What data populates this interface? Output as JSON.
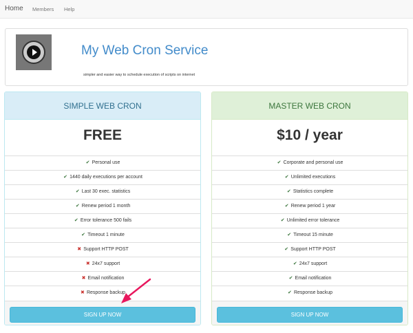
{
  "nav": {
    "brand": "Home",
    "links": [
      "Members",
      "Help"
    ]
  },
  "header": {
    "logo_icon": "play-clock-icon",
    "title": "My Web Cron Service",
    "tagline": "simpler and easier way to schedule execution of scripts on internet"
  },
  "plans": [
    {
      "name": "SIMPLE WEB CRON",
      "price": "FREE",
      "features": [
        {
          "text": "Personal use",
          "included": true
        },
        {
          "text": "1440 daily executions per account",
          "included": true
        },
        {
          "text": "Last 30 exec. statistics",
          "included": true
        },
        {
          "text": "Renew period 1 month",
          "included": true
        },
        {
          "text": "Error tolerance 500 fails",
          "included": true
        },
        {
          "text": "Timeout 1 minute",
          "included": true
        },
        {
          "text": "Support HTTP POST",
          "included": false
        },
        {
          "text": "24x7 support",
          "included": false
        },
        {
          "text": "Email notification",
          "included": false
        },
        {
          "text": "Response backup",
          "included": false
        }
      ],
      "button": "SIGN UP NOW"
    },
    {
      "name": "MASTER WEB CRON",
      "price": "$10 / year",
      "features": [
        {
          "text": "Corporate and personal use",
          "included": true
        },
        {
          "text": "Unlimited executions",
          "included": true
        },
        {
          "text": "Statistics complete",
          "included": true
        },
        {
          "text": "Renew period 1 year",
          "included": true
        },
        {
          "text": "Unlimited error tolerance",
          "included": true
        },
        {
          "text": "Timeout 15 minute",
          "included": true
        },
        {
          "text": "Support HTTP POST",
          "included": true
        },
        {
          "text": "24x7 support",
          "included": true
        },
        {
          "text": "Email notification",
          "included": true
        },
        {
          "text": "Response backup",
          "included": true
        }
      ],
      "button": "SIGN UP NOW"
    }
  ],
  "icons": {
    "included": "check-icon",
    "excluded": "cross-icon"
  },
  "colors": {
    "accent": "#428bca",
    "simple_heading_bg": "#d9edf7",
    "master_heading_bg": "#dff0d8",
    "button": "#5bc0de",
    "check": "#3c763d",
    "cross": "#c9302c",
    "annotation_arrow": "#e8175d"
  }
}
